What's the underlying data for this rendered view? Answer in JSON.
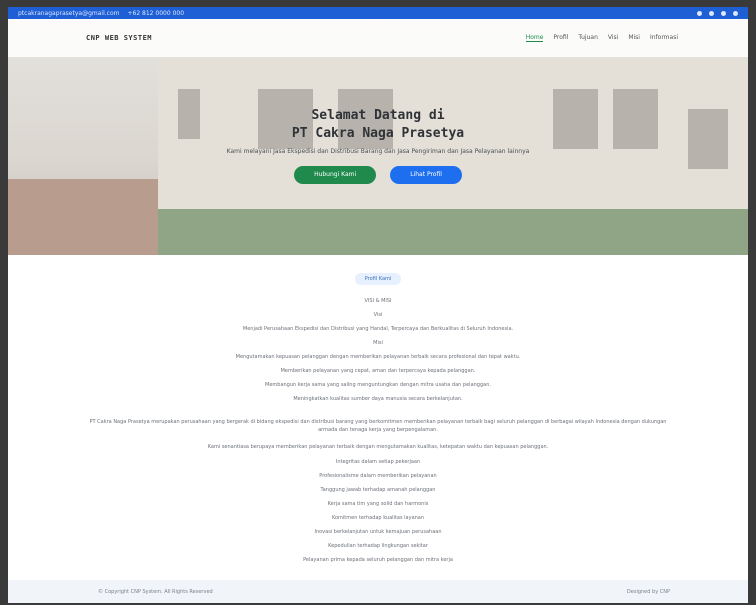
{
  "topbar": {
    "email": "ptcakranagaprasetya@gmail.com",
    "phone": "+62 812 0000 000",
    "socials": [
      "twitter-icon",
      "facebook-icon",
      "instagram-icon",
      "linkedin-icon"
    ]
  },
  "nav": {
    "brand": "CNP WEB SYSTEM",
    "items": [
      "Home",
      "Profil",
      "Tujuan",
      "Visi",
      "Misi",
      "Informasi"
    ]
  },
  "hero": {
    "title_line1": "Selamat Datang di",
    "title_line2": "PT Cakra Naga Prasetya",
    "subtitle": "Kami melayani Jasa Ekspedisi dan Distribusi Barang dan Jasa Pengiriman dan Jasa Pelayanan lainnya",
    "btn_primary": "Hubungi Kami",
    "btn_secondary": "Lihat Profil"
  },
  "main": {
    "pill": "Profil Kami",
    "heading": "VISI & MISI",
    "visi_label": "Visi",
    "visi_text": "Menjadi Perusahaan Ekspedisi dan Distribusi yang Handal, Terpercaya dan Berkualitas di Seluruh Indonesia.",
    "misi_label": "Misi",
    "misi_items": [
      "Mengutamakan kepuasan pelanggan dengan memberikan pelayanan terbaik secara profesional dan tepat waktu.",
      "Memberikan pelayanan yang cepat, aman dan terpercaya kepada pelanggan.",
      "Membangun kerja sama yang saling menguntungkan dengan mitra usaha dan pelanggan.",
      "Meningkatkan kualitas sumber daya manusia secara berkelanjutan."
    ],
    "para1": "PT Cakra Naga Prasetya merupakan perusahaan yang bergerak di bidang ekspedisi dan distribusi barang yang berkomitmen memberikan pelayanan terbaik bagi seluruh pelanggan di berbagai wilayah Indonesia dengan dukungan armada dan tenaga kerja yang berpengalaman.",
    "para2": "Kami senantiasa berupaya memberikan pelayanan terbaik dengan mengutamakan kualitas, ketepatan waktu dan kepuasan pelanggan.",
    "values": [
      "Integritas dalam setiap pekerjaan",
      "Profesionalisme dalam memberikan pelayanan",
      "Tanggung jawab terhadap amanah pelanggan",
      "Kerja sama tim yang solid dan harmonis",
      "Komitmen terhadap kualitas layanan",
      "Inovasi berkelanjutan untuk kemajuan perusahaan",
      "Kepedulian terhadap lingkungan sekitar",
      "Pelayanan prima kepada seluruh pelanggan dan mitra kerja"
    ]
  },
  "footer": {
    "left": "© Copyright CNP System. All Rights Reserved",
    "right": "Designed by CNP"
  }
}
